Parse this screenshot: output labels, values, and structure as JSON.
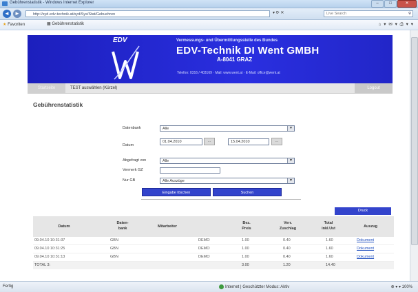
{
  "browser": {
    "title": "Gebührenstatistik - Windows Internet Explorer",
    "address": "http://syd.edv-technik.at/syd/Sys/Stat/Gebuehren",
    "search_placeholder": "Live Search",
    "favorites_label": "Favoriten",
    "tab_label": "Gebührenstatistik",
    "window_buttons": {
      "minimize": "–",
      "maximize": "□",
      "close": "✕"
    },
    "nav_back": "◄",
    "nav_forward": "►",
    "address_controls": "▾ ⟳ ✕",
    "tools_label": "⌂ ▾ ✉ ▾ ⎙ ▾ ▾"
  },
  "banner": {
    "logo_text": "EDV",
    "subtitle": "Vermessungs- und Übermittlungsstelle des Bundes",
    "company": "EDV-Technik DI Went GMBH",
    "city": "A-8041 GRAZ",
    "contact": "Telefon: 0316 / 403169  ·  Mail: www.went.at  ·  E-Mail: office@went.at"
  },
  "menu": {
    "left": "Startseite",
    "middle": "TEST auswählen (Kürzel)",
    "right": "Logout"
  },
  "form": {
    "heading": "Gebührenstatistik",
    "datenbank_label": "Datenbank",
    "datenbank_value": "Alle",
    "datum_label": "Datum",
    "date_from": "01.04.2010",
    "date_to": "15.04.2010",
    "date_picker": "...",
    "mitarbeiter_label": "Abgefragt von",
    "mitarbeiter_value": "Alle",
    "aktenzahl_label": "Vermerk GZ",
    "aktenzahl_value": "",
    "ansicht_label": "Nur GB",
    "ansicht_value": "Alle Auszüge",
    "dropdown_arrow": "▼",
    "submit_label": "Eingabe löschen",
    "search_label": "Suchen",
    "sort_label": "Druck"
  },
  "table": {
    "columns": [
      "Datum",
      "Daten-\nbank",
      "Mitarbeiter",
      "Bez.\nPreis",
      "Verr.\nZuschlag",
      "Total\ninkl.Ust",
      "Auszug"
    ],
    "rows": [
      {
        "datum": "09.04.10 10:31:37",
        "db": "GBN",
        "ma": "DEMO",
        "preis": "1.00",
        "zuschlag": "0.40",
        "total": "1.60",
        "auszug": "Dokument"
      },
      {
        "datum": "09.04.10 10:31:25",
        "db": "GBN",
        "ma": "DEMO",
        "preis": "1.00",
        "zuschlag": "0.40",
        "total": "1.60",
        "auszug": "Dokument"
      },
      {
        "datum": "09.04.10 10:31:13",
        "db": "GBN",
        "ma": "DEMO",
        "preis": "1.00",
        "zuschlag": "0.40",
        "total": "1.60",
        "auszug": "Dokument"
      }
    ],
    "footer": {
      "label": "TOTAL 3:",
      "preis": "3.00",
      "zuschlag": "1.20",
      "total": "14.40"
    }
  },
  "status": {
    "left": "Fertig",
    "zone": "Internet | Geschützter Modus: Aktiv",
    "zoom": "100%",
    "zoom_controls": "⊕ ▾ ▾"
  }
}
